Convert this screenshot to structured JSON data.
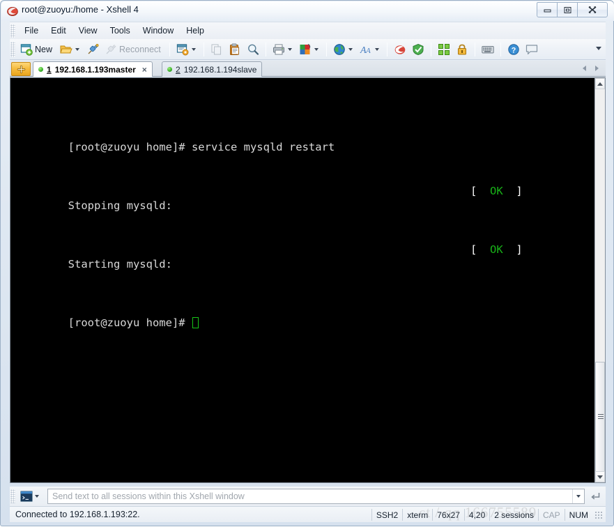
{
  "window": {
    "title": "root@zuoyu:/home - Xshell 4",
    "app_icon": "xshell-logo-icon",
    "controls": {
      "minimize": "minimize-icon",
      "maximize": "restore-icon",
      "close": "close-icon"
    }
  },
  "menu": {
    "items": [
      {
        "label": "File"
      },
      {
        "label": "Edit"
      },
      {
        "label": "View"
      },
      {
        "label": "Tools"
      },
      {
        "label": "Window"
      },
      {
        "label": "Help"
      }
    ]
  },
  "toolbar": {
    "new_label": "New",
    "reconnect_label": "Reconnect",
    "overflow": "toolbar-overflow-chevron",
    "buttons": [
      {
        "name": "new-session-button",
        "icon": "new-window-icon"
      },
      {
        "name": "open-session-button",
        "icon": "open-folder-icon",
        "has_caret": true
      },
      {
        "name": "connect-button",
        "icon": "plug-connect-icon"
      },
      {
        "name": "reconnect-button",
        "icon": "plug-disconnect-icon",
        "disabled": true
      },
      {
        "name": "properties-button",
        "icon": "session-properties-icon",
        "has_caret": true
      },
      {
        "name": "copy-button",
        "icon": "copy-icon",
        "disabled": true
      },
      {
        "name": "paste-button",
        "icon": "clipboard-paste-icon"
      },
      {
        "name": "find-button",
        "icon": "magnifier-icon"
      },
      {
        "name": "print-button",
        "icon": "printer-icon",
        "has_caret": true
      },
      {
        "name": "color-scheme-button",
        "icon": "color-palette-icon",
        "has_caret": true
      },
      {
        "name": "language-encoding-button",
        "icon": "globe-icon",
        "has_caret": true
      },
      {
        "name": "font-button",
        "icon": "font-letter-icon",
        "has_caret": true
      },
      {
        "name": "xftp-button",
        "icon": "xftp-red-icon"
      },
      {
        "name": "xagent-button",
        "icon": "xagent-green-icon"
      },
      {
        "name": "fullscreen-button",
        "icon": "fullscreen-arrows-icon"
      },
      {
        "name": "lock-button",
        "icon": "padlock-icon"
      },
      {
        "name": "keyboard-button",
        "icon": "keyboard-icon"
      },
      {
        "name": "help-button",
        "icon": "question-mark-icon"
      },
      {
        "name": "chat-button",
        "icon": "speech-bubble-icon"
      }
    ]
  },
  "tabs": {
    "new_tab_icon": "new-tab-plus-icon",
    "items": [
      {
        "num": "1",
        "label": "192.168.1.193master",
        "active": true,
        "status": "connected",
        "close": "×"
      },
      {
        "num": "2",
        "label": "192.168.1.194slave",
        "active": false,
        "status": "connected"
      }
    ],
    "scroll_left": "tab-scroll-left-icon",
    "scroll_right": "tab-scroll-right-icon"
  },
  "terminal": {
    "lines": [
      {
        "text": "[root@zuoyu home]# service mysqld restart",
        "ok": null
      },
      {
        "text": "Stopping mysqld:",
        "ok": "OK"
      },
      {
        "text": "Starting mysqld:",
        "ok": "OK"
      },
      {
        "text": "[root@zuoyu home]# ",
        "ok": null,
        "cursor": true
      }
    ],
    "ok_open_bracket": "[",
    "ok_close_bracket": "]",
    "ok_text": "OK",
    "colors": {
      "background": "#000000",
      "foreground": "#d8d8d8",
      "ok_green": "#18b218",
      "bracket_white": "#ffffff",
      "cursor_green": "#18c418"
    }
  },
  "send_bar": {
    "mode_icon": "terminal-window-icon",
    "placeholder": "Send text to all sessions within this Xshell window",
    "value": "",
    "dropdown_icon": "chevron-down-icon",
    "enter_icon": "enter-return-icon"
  },
  "status_bar": {
    "message": "Connected to 192.168.1.193:22.",
    "segments": [
      {
        "label": "SSH2",
        "name": "status-protocol",
        "dim": false
      },
      {
        "label": "xterm",
        "name": "status-terminal-type",
        "dim": false
      },
      {
        "label": "76x27",
        "name": "status-dimensions",
        "dim": false
      },
      {
        "label": "4,20",
        "name": "status-cursor-position",
        "dim": false
      },
      {
        "label": "2 sessions",
        "name": "status-session-count",
        "dim": false
      },
      {
        "label": "CAP",
        "name": "status-caps-lock",
        "dim": true
      },
      {
        "label": "NUM",
        "name": "status-num-lock",
        "dim": false
      }
    ],
    "watermark": "ct / qq  166755589"
  }
}
